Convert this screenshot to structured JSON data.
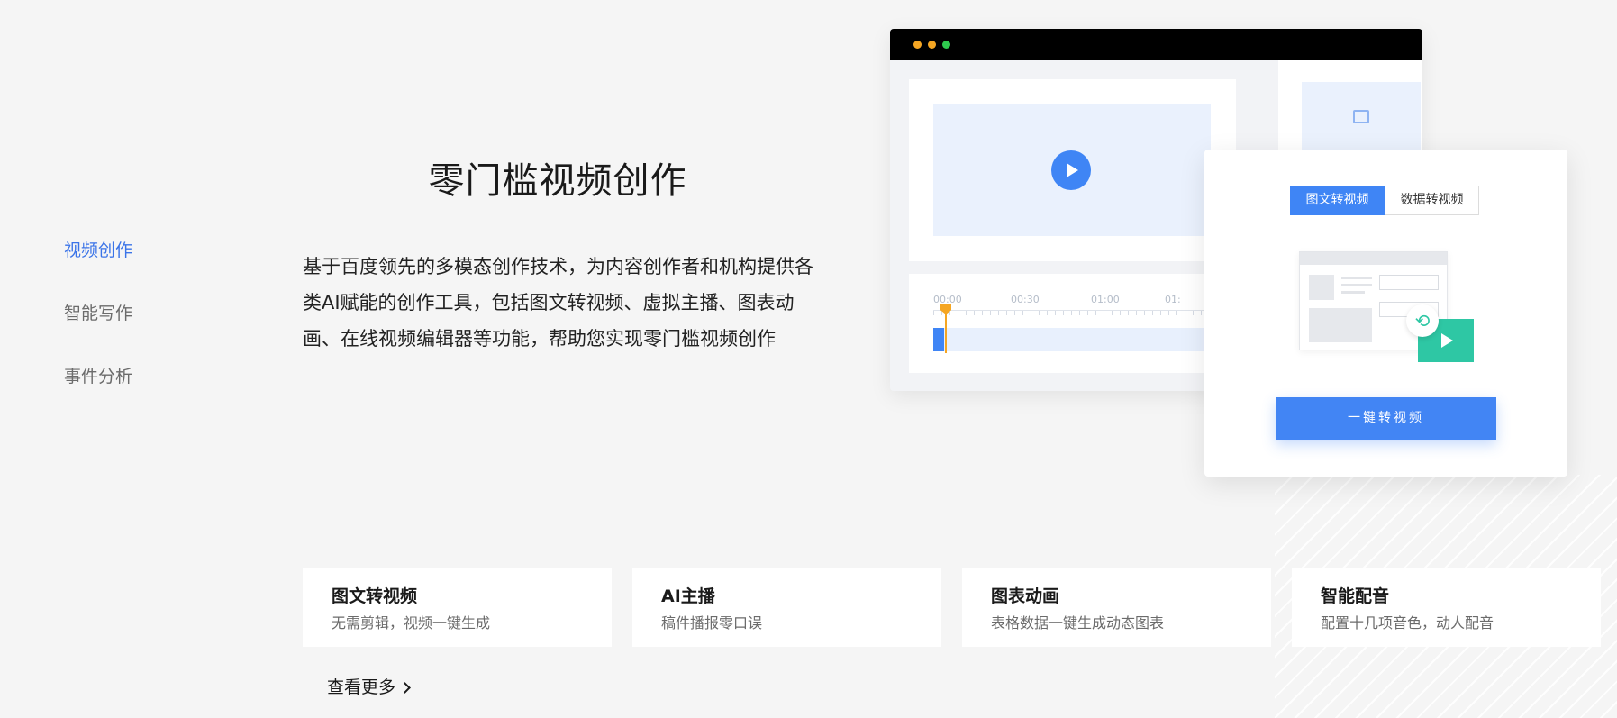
{
  "nav": {
    "items": [
      {
        "label": "视频创作",
        "active": true
      },
      {
        "label": "智能写作",
        "active": false
      },
      {
        "label": "事件分析",
        "active": false
      }
    ]
  },
  "hero": {
    "title": "零门槛视频创作",
    "desc": "基于百度领先的多模态创作技术，为内容创作者和机构提供各类AI赋能的创作工具，包括图文转视频、虚拟主播、图表动画、在线视频编辑器等功能，帮助您实现零门槛视频创作"
  },
  "mockup": {
    "window_dots": [
      "#f5a623",
      "#f5a623",
      "#2ec94e"
    ],
    "ticks": [
      "00:00",
      "00:30",
      "01:00",
      "01:"
    ],
    "tabs": [
      {
        "label": "图文转视频",
        "active": true
      },
      {
        "label": "数据转视频",
        "active": false
      }
    ],
    "convert_label": "一键转视频",
    "icons": [
      "play-icon",
      "image-icon",
      "refresh-icon"
    ]
  },
  "features": [
    {
      "title": "图文转视频",
      "desc": "无需剪辑，视频一键生成"
    },
    {
      "title": "AI主播",
      "desc": "稿件播报零口误"
    },
    {
      "title": "图表动画",
      "desc": "表格数据一键生成动态图表"
    },
    {
      "title": "智能配音",
      "desc": "配置十几项音色，动人配音"
    }
  ],
  "more_label": "查看更多",
  "colors": {
    "accent": "#3f85f5",
    "green": "#2ec7a4",
    "orange": "#f5a623"
  }
}
